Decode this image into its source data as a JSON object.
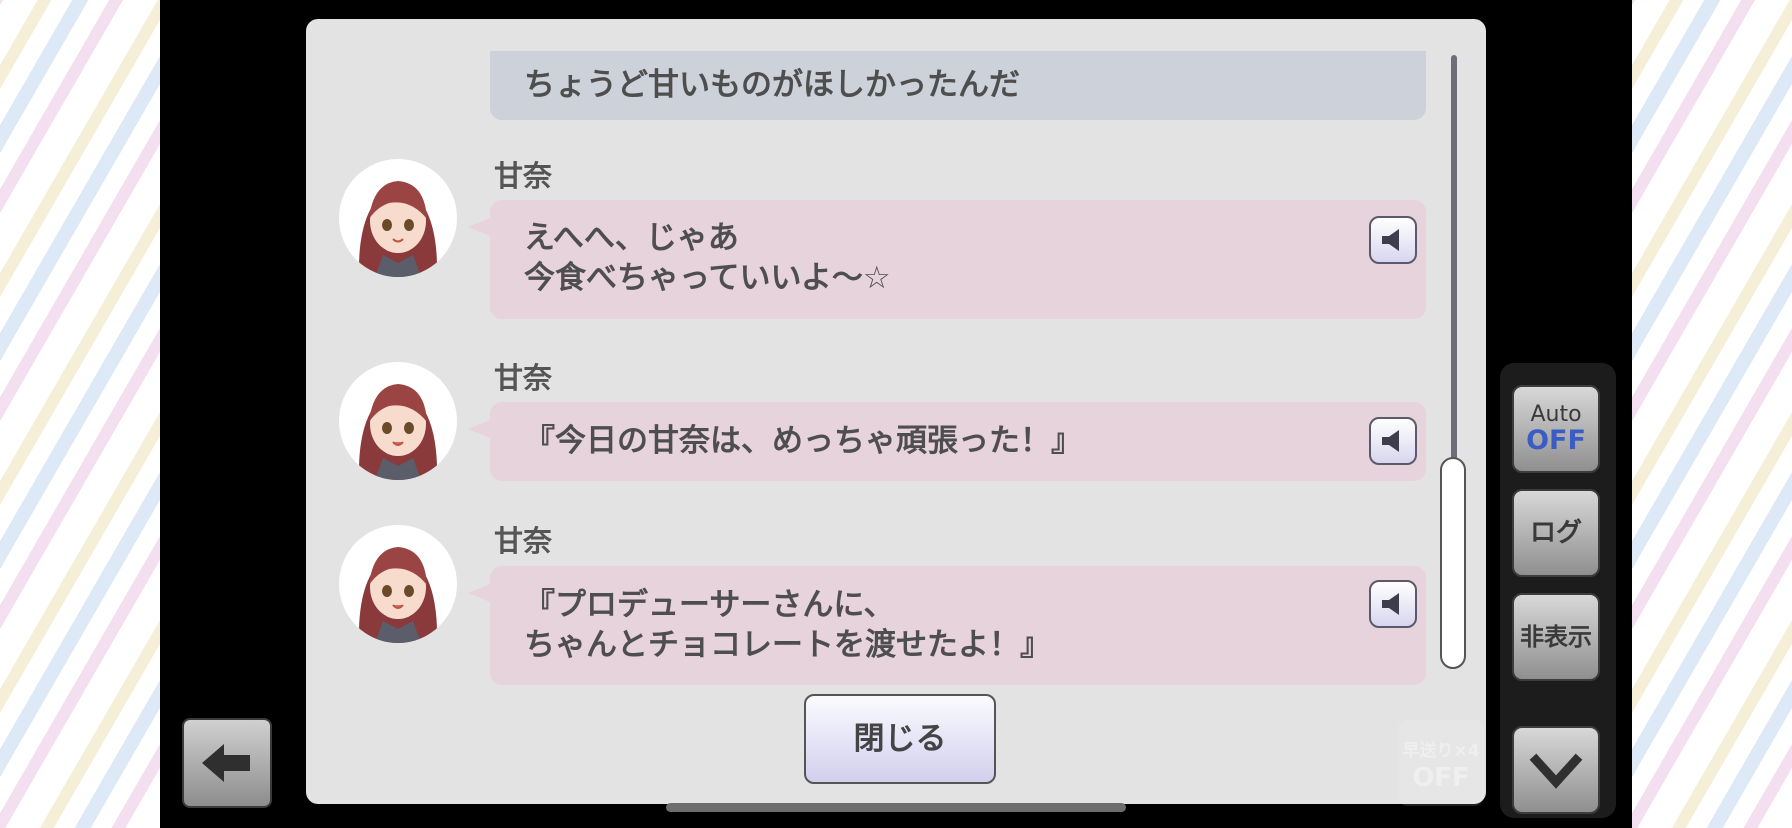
{
  "log": {
    "previous_line": "ちょうど甘いものがほしかったんだ",
    "entries": [
      {
        "speaker": "甘奈",
        "line1": "えへへ、じゃあ",
        "line2": "今食べちゃっていいよ～☆"
      },
      {
        "speaker": "甘奈",
        "line1": "『今日の甘奈は、めっちゃ頑張った！』",
        "line2": ""
      },
      {
        "speaker": "甘奈",
        "line1": "『プロデューサーさんに、",
        "line2": "ちゃんとチョコレートを渡せたよ！』"
      }
    ]
  },
  "buttons": {
    "close": "閉じる",
    "auto_label": "Auto",
    "auto_state": "OFF",
    "log": "ログ",
    "hide": "非表示",
    "fast_forward_label": "早送り×4",
    "fast_forward_state": "OFF"
  },
  "colors": {
    "bubble_pink": "#e7d3dc",
    "bubble_grey": "#cdd1d9",
    "auto_off_blue": "#3b5cc4"
  },
  "icons": [
    "speaker-icon",
    "back-arrow-icon",
    "chevron-down-icon"
  ]
}
